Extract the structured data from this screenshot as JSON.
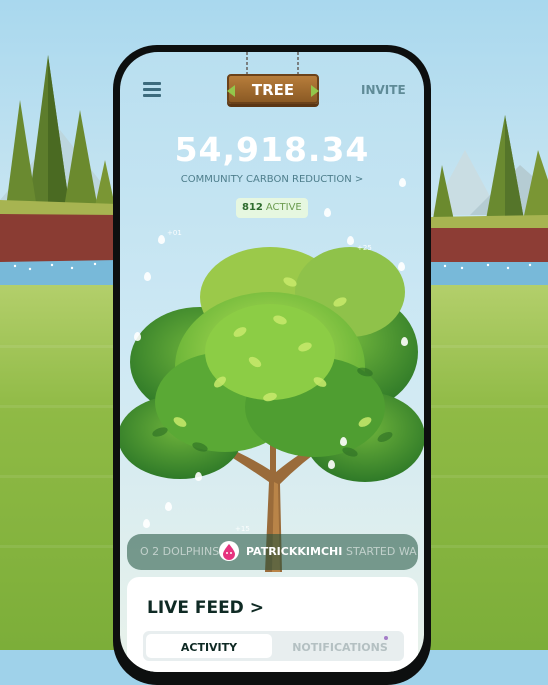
{
  "header": {
    "title": "TREE",
    "invite_label": "INVITE",
    "menu_icon": "hamburger-menu-icon"
  },
  "stats": {
    "carbon_total": "54,918.34",
    "carbon_label": "COMMUNITY CARBON REDUCTION >",
    "active_count": "812",
    "active_label": "ACTIVE"
  },
  "floating_numbers": [
    "+01",
    "+25",
    "+15"
  ],
  "ticker": {
    "text_before": "O 2 DOLPHINS",
    "username": "PATRICKKIMCHI",
    "text_after": "STARTED WA",
    "avatar_icon": "droplet-avatar-icon"
  },
  "live_feed": {
    "title": "LIVE FEED >",
    "tabs": [
      {
        "label": "ACTIVITY",
        "selected": true
      },
      {
        "label": "NOTIFICATIONS",
        "selected": false,
        "has_dot": true
      }
    ]
  },
  "colors": {
    "accent_green": "#93c74b",
    "dark_text": "#0f2a24",
    "notification_dot": "#a47cc7",
    "avatar_pink": "#e6347f"
  }
}
